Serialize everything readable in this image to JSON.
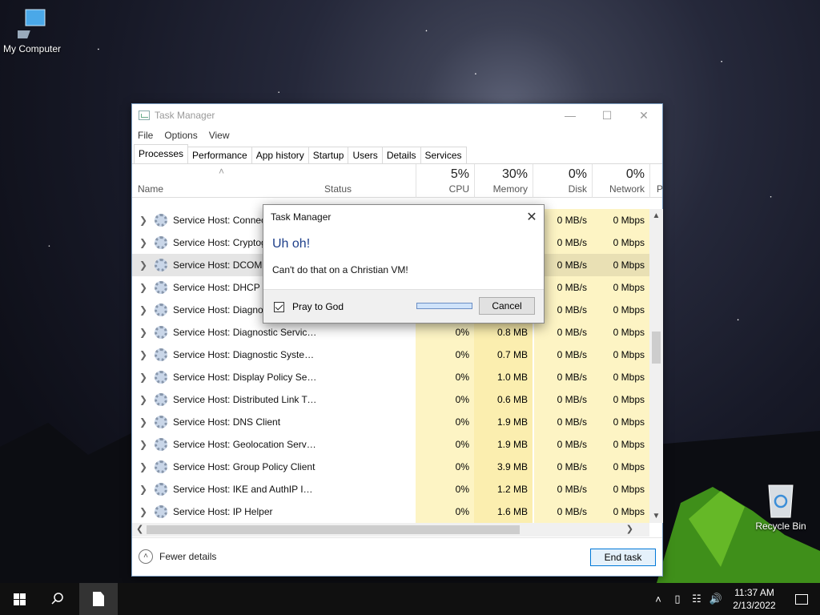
{
  "desktop": {
    "icons": [
      {
        "label": "My Computer",
        "icon": "computer-icon"
      },
      {
        "label": "Recycle Bin",
        "icon": "recycle-bin-icon"
      }
    ]
  },
  "window": {
    "title": "Task Manager",
    "menu": [
      "File",
      "Options",
      "View"
    ],
    "tabs": [
      "Processes",
      "Performance",
      "App history",
      "Startup",
      "Users",
      "Details",
      "Services"
    ],
    "active_tab": "Processes",
    "columns": {
      "name": "Name",
      "status": "Status",
      "cpu": {
        "label": "CPU",
        "pct": "5%"
      },
      "memory": {
        "label": "Memory",
        "pct": "30%"
      },
      "disk": {
        "label": "Disk",
        "pct": "0%"
      },
      "network": {
        "label": "Network",
        "pct": "0%"
      },
      "extra": "P"
    },
    "rows": [
      {
        "name": "Service Host: Connected...",
        "cpu": "",
        "mem": "",
        "disk": "0 MB/s",
        "net": "0 Mbps"
      },
      {
        "name": "Service Host: Cryptog...",
        "cpu": "",
        "mem": "",
        "disk": "0 MB/s",
        "net": "0 Mbps"
      },
      {
        "name": "Service Host: DCOM S...",
        "cpu": "",
        "mem": "",
        "disk": "0 MB/s",
        "net": "0 Mbps",
        "selected": true
      },
      {
        "name": "Service Host: DHCP C...",
        "cpu": "",
        "mem": "",
        "disk": "0 MB/s",
        "net": "0 Mbps"
      },
      {
        "name": "Service Host: Diagnos...",
        "cpu": "",
        "mem": "",
        "disk": "0 MB/s",
        "net": "0 Mbps"
      },
      {
        "name": "Service Host: Diagnostic Service...",
        "cpu": "0%",
        "mem": "0.8 MB",
        "disk": "0 MB/s",
        "net": "0 Mbps"
      },
      {
        "name": "Service Host: Diagnostic System...",
        "cpu": "0%",
        "mem": "0.7 MB",
        "disk": "0 MB/s",
        "net": "0 Mbps"
      },
      {
        "name": "Service Host: Display Policy Serv...",
        "cpu": "0%",
        "mem": "1.0 MB",
        "disk": "0 MB/s",
        "net": "0 Mbps"
      },
      {
        "name": "Service Host: Distributed Link Tr...",
        "cpu": "0%",
        "mem": "0.6 MB",
        "disk": "0 MB/s",
        "net": "0 Mbps"
      },
      {
        "name": "Service Host: DNS Client",
        "cpu": "0%",
        "mem": "1.9 MB",
        "disk": "0 MB/s",
        "net": "0 Mbps"
      },
      {
        "name": "Service Host: Geolocation Service",
        "cpu": "0%",
        "mem": "1.9 MB",
        "disk": "0 MB/s",
        "net": "0 Mbps"
      },
      {
        "name": "Service Host: Group Policy Client",
        "cpu": "0%",
        "mem": "3.9 MB",
        "disk": "0 MB/s",
        "net": "0 Mbps"
      },
      {
        "name": "Service Host: IKE and AuthIP IPs...",
        "cpu": "0%",
        "mem": "1.2 MB",
        "disk": "0 MB/s",
        "net": "0 Mbps"
      },
      {
        "name": "Service Host: IP Helper",
        "cpu": "0%",
        "mem": "1.6 MB",
        "disk": "0 MB/s",
        "net": "0 Mbps"
      }
    ],
    "footer": {
      "fewer_details": "Fewer details",
      "end_task": "End task"
    }
  },
  "dialog": {
    "title": "Task Manager",
    "heading": "Uh oh!",
    "message": "Can't do that on a Christian VM!",
    "checkbox_label": "Pray to God",
    "checkbox_checked": true,
    "cancel_label": "Cancel"
  },
  "taskbar": {
    "time": "11:37 AM",
    "date": "2/13/2022"
  }
}
